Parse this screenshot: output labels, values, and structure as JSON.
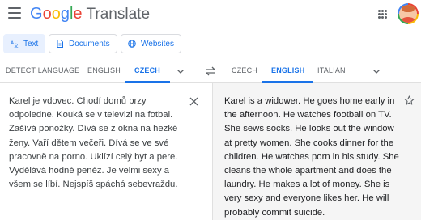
{
  "header": {
    "logo_brand": "Google",
    "logo_product": "Translate",
    "logo_colors": [
      "#4285f4",
      "#ea4335",
      "#fbbc05",
      "#4285f4",
      "#34a853",
      "#ea4335"
    ],
    "menu_icon": "hamburger-menu-icon",
    "apps_icon": "apps-grid-icon",
    "avatar": "user-avatar"
  },
  "modes": [
    {
      "label": "Text",
      "icon": "translate-text-icon",
      "active": true
    },
    {
      "label": "Documents",
      "icon": "document-icon",
      "active": false
    },
    {
      "label": "Websites",
      "icon": "globe-icon",
      "active": false
    }
  ],
  "source_langs": {
    "detect": "DETECT LANGUAGE",
    "english": "ENGLISH",
    "czech": "CZECH"
  },
  "target_langs": {
    "czech": "CZECH",
    "english": "ENGLISH",
    "italian": "ITALIAN"
  },
  "source_text": "Karel je vdovec. Chodí domů brzy odpoledne. Kouká se v televizi na fotbal. Zašívá ponožky. Dívá se z okna na hezké ženy. Vaří dětem večeři. Dívá se ve své pracovně na porno. Uklízí celý byt a pere. Vydělává hodně peněz. Je velmi sexy a všem se líbí. Nejspíš spáchá sebevraždu.",
  "translation_text": "Karel is a widower. He goes home early in the afternoon. He watches football on TV. She sews socks. He looks out the window at pretty women. She cooks dinner for the children. He watches porn in his study. She cleans the whole apartment and does the laundry. He makes a lot of money. She is very sexy and everyone likes her. He will probably commit suicide.",
  "colors": {
    "accent": "#1a73e8",
    "active_mode_bg": "#e8f0fe",
    "target_panel_bg": "#f5f5f5"
  }
}
